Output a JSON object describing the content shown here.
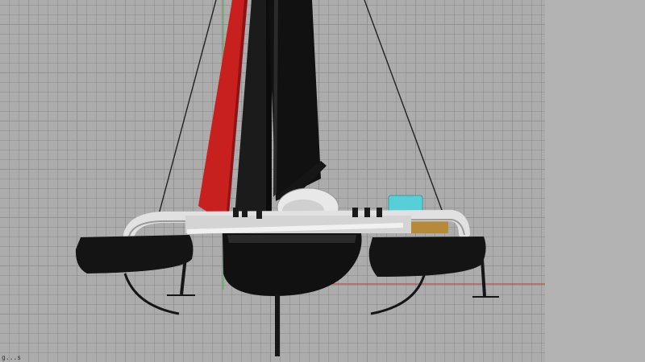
{
  "viewport": {
    "background": "#acacac",
    "axis_colors": {
      "x_axis": "#c0392b",
      "y_axis": "#4caf50"
    }
  },
  "model": {
    "jib_color": "#c8201e",
    "mainsail_color": "#111111",
    "hull_color": "#141414",
    "crossbeam_color": "#d8d8d8",
    "pod_color": "#56cfd6",
    "deck_accent": "#b58a3a",
    "foil_color": "#151515"
  },
  "status": {
    "label": "g...s"
  }
}
